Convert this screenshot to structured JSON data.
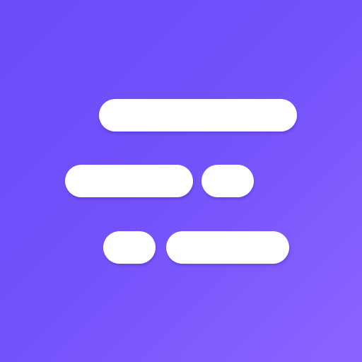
{
  "icon": {
    "name": "text-lines-logo-icon",
    "background_colors": [
      "#6a4bf7",
      "#8b64ff"
    ],
    "bar_color": "#ffffff"
  }
}
